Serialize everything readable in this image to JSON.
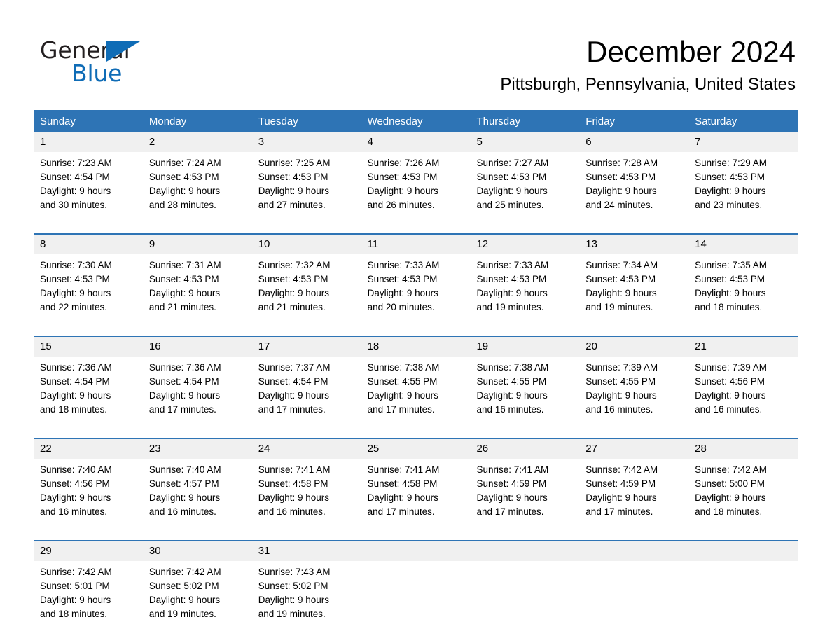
{
  "brand": {
    "name_part1": "General",
    "name_part2": "Blue",
    "triangle_color": "#0f6cb6"
  },
  "header": {
    "month_title": "December 2024",
    "location": "Pittsburgh, Pennsylvania, United States",
    "accent_color": "#2e74b5",
    "daynum_band_color": "#f0f0f0"
  },
  "weekday_headers": [
    "Sunday",
    "Monday",
    "Tuesday",
    "Wednesday",
    "Thursday",
    "Friday",
    "Saturday"
  ],
  "weeks": [
    {
      "days": [
        {
          "number": "1",
          "sunrise": "Sunrise: 7:23 AM",
          "sunset": "Sunset: 4:54 PM",
          "daylight_line1": "Daylight: 9 hours",
          "daylight_line2": "and 30 minutes."
        },
        {
          "number": "2",
          "sunrise": "Sunrise: 7:24 AM",
          "sunset": "Sunset: 4:53 PM",
          "daylight_line1": "Daylight: 9 hours",
          "daylight_line2": "and 28 minutes."
        },
        {
          "number": "3",
          "sunrise": "Sunrise: 7:25 AM",
          "sunset": "Sunset: 4:53 PM",
          "daylight_line1": "Daylight: 9 hours",
          "daylight_line2": "and 27 minutes."
        },
        {
          "number": "4",
          "sunrise": "Sunrise: 7:26 AM",
          "sunset": "Sunset: 4:53 PM",
          "daylight_line1": "Daylight: 9 hours",
          "daylight_line2": "and 26 minutes."
        },
        {
          "number": "5",
          "sunrise": "Sunrise: 7:27 AM",
          "sunset": "Sunset: 4:53 PM",
          "daylight_line1": "Daylight: 9 hours",
          "daylight_line2": "and 25 minutes."
        },
        {
          "number": "6",
          "sunrise": "Sunrise: 7:28 AM",
          "sunset": "Sunset: 4:53 PM",
          "daylight_line1": "Daylight: 9 hours",
          "daylight_line2": "and 24 minutes."
        },
        {
          "number": "7",
          "sunrise": "Sunrise: 7:29 AM",
          "sunset": "Sunset: 4:53 PM",
          "daylight_line1": "Daylight: 9 hours",
          "daylight_line2": "and 23 minutes."
        }
      ]
    },
    {
      "days": [
        {
          "number": "8",
          "sunrise": "Sunrise: 7:30 AM",
          "sunset": "Sunset: 4:53 PM",
          "daylight_line1": "Daylight: 9 hours",
          "daylight_line2": "and 22 minutes."
        },
        {
          "number": "9",
          "sunrise": "Sunrise: 7:31 AM",
          "sunset": "Sunset: 4:53 PM",
          "daylight_line1": "Daylight: 9 hours",
          "daylight_line2": "and 21 minutes."
        },
        {
          "number": "10",
          "sunrise": "Sunrise: 7:32 AM",
          "sunset": "Sunset: 4:53 PM",
          "daylight_line1": "Daylight: 9 hours",
          "daylight_line2": "and 21 minutes."
        },
        {
          "number": "11",
          "sunrise": "Sunrise: 7:33 AM",
          "sunset": "Sunset: 4:53 PM",
          "daylight_line1": "Daylight: 9 hours",
          "daylight_line2": "and 20 minutes."
        },
        {
          "number": "12",
          "sunrise": "Sunrise: 7:33 AM",
          "sunset": "Sunset: 4:53 PM",
          "daylight_line1": "Daylight: 9 hours",
          "daylight_line2": "and 19 minutes."
        },
        {
          "number": "13",
          "sunrise": "Sunrise: 7:34 AM",
          "sunset": "Sunset: 4:53 PM",
          "daylight_line1": "Daylight: 9 hours",
          "daylight_line2": "and 19 minutes."
        },
        {
          "number": "14",
          "sunrise": "Sunrise: 7:35 AM",
          "sunset": "Sunset: 4:53 PM",
          "daylight_line1": "Daylight: 9 hours",
          "daylight_line2": "and 18 minutes."
        }
      ]
    },
    {
      "days": [
        {
          "number": "15",
          "sunrise": "Sunrise: 7:36 AM",
          "sunset": "Sunset: 4:54 PM",
          "daylight_line1": "Daylight: 9 hours",
          "daylight_line2": "and 18 minutes."
        },
        {
          "number": "16",
          "sunrise": "Sunrise: 7:36 AM",
          "sunset": "Sunset: 4:54 PM",
          "daylight_line1": "Daylight: 9 hours",
          "daylight_line2": "and 17 minutes."
        },
        {
          "number": "17",
          "sunrise": "Sunrise: 7:37 AM",
          "sunset": "Sunset: 4:54 PM",
          "daylight_line1": "Daylight: 9 hours",
          "daylight_line2": "and 17 minutes."
        },
        {
          "number": "18",
          "sunrise": "Sunrise: 7:38 AM",
          "sunset": "Sunset: 4:55 PM",
          "daylight_line1": "Daylight: 9 hours",
          "daylight_line2": "and 17 minutes."
        },
        {
          "number": "19",
          "sunrise": "Sunrise: 7:38 AM",
          "sunset": "Sunset: 4:55 PM",
          "daylight_line1": "Daylight: 9 hours",
          "daylight_line2": "and 16 minutes."
        },
        {
          "number": "20",
          "sunrise": "Sunrise: 7:39 AM",
          "sunset": "Sunset: 4:55 PM",
          "daylight_line1": "Daylight: 9 hours",
          "daylight_line2": "and 16 minutes."
        },
        {
          "number": "21",
          "sunrise": "Sunrise: 7:39 AM",
          "sunset": "Sunset: 4:56 PM",
          "daylight_line1": "Daylight: 9 hours",
          "daylight_line2": "and 16 minutes."
        }
      ]
    },
    {
      "days": [
        {
          "number": "22",
          "sunrise": "Sunrise: 7:40 AM",
          "sunset": "Sunset: 4:56 PM",
          "daylight_line1": "Daylight: 9 hours",
          "daylight_line2": "and 16 minutes."
        },
        {
          "number": "23",
          "sunrise": "Sunrise: 7:40 AM",
          "sunset": "Sunset: 4:57 PM",
          "daylight_line1": "Daylight: 9 hours",
          "daylight_line2": "and 16 minutes."
        },
        {
          "number": "24",
          "sunrise": "Sunrise: 7:41 AM",
          "sunset": "Sunset: 4:58 PM",
          "daylight_line1": "Daylight: 9 hours",
          "daylight_line2": "and 16 minutes."
        },
        {
          "number": "25",
          "sunrise": "Sunrise: 7:41 AM",
          "sunset": "Sunset: 4:58 PM",
          "daylight_line1": "Daylight: 9 hours",
          "daylight_line2": "and 17 minutes."
        },
        {
          "number": "26",
          "sunrise": "Sunrise: 7:41 AM",
          "sunset": "Sunset: 4:59 PM",
          "daylight_line1": "Daylight: 9 hours",
          "daylight_line2": "and 17 minutes."
        },
        {
          "number": "27",
          "sunrise": "Sunrise: 7:42 AM",
          "sunset": "Sunset: 4:59 PM",
          "daylight_line1": "Daylight: 9 hours",
          "daylight_line2": "and 17 minutes."
        },
        {
          "number": "28",
          "sunrise": "Sunrise: 7:42 AM",
          "sunset": "Sunset: 5:00 PM",
          "daylight_line1": "Daylight: 9 hours",
          "daylight_line2": "and 18 minutes."
        }
      ]
    },
    {
      "days": [
        {
          "number": "29",
          "sunrise": "Sunrise: 7:42 AM",
          "sunset": "Sunset: 5:01 PM",
          "daylight_line1": "Daylight: 9 hours",
          "daylight_line2": "and 18 minutes."
        },
        {
          "number": "30",
          "sunrise": "Sunrise: 7:42 AM",
          "sunset": "Sunset: 5:02 PM",
          "daylight_line1": "Daylight: 9 hours",
          "daylight_line2": "and 19 minutes."
        },
        {
          "number": "31",
          "sunrise": "Sunrise: 7:43 AM",
          "sunset": "Sunset: 5:02 PM",
          "daylight_line1": "Daylight: 9 hours",
          "daylight_line2": "and 19 minutes."
        },
        {
          "number": "",
          "sunrise": "",
          "sunset": "",
          "daylight_line1": "",
          "daylight_line2": ""
        },
        {
          "number": "",
          "sunrise": "",
          "sunset": "",
          "daylight_line1": "",
          "daylight_line2": ""
        },
        {
          "number": "",
          "sunrise": "",
          "sunset": "",
          "daylight_line1": "",
          "daylight_line2": ""
        },
        {
          "number": "",
          "sunrise": "",
          "sunset": "",
          "daylight_line1": "",
          "daylight_line2": ""
        }
      ]
    }
  ]
}
